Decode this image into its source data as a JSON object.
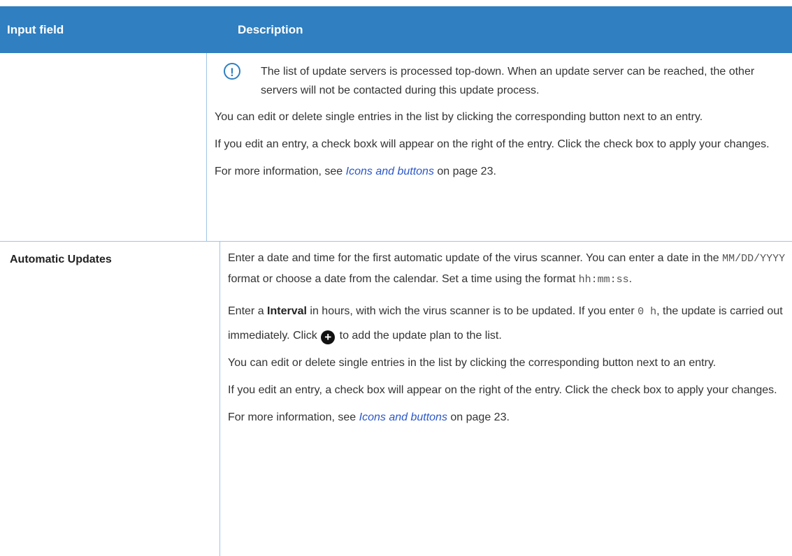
{
  "header": {
    "col1": "Input field",
    "col2": "Description"
  },
  "row1": {
    "field": "",
    "note": "The list of update servers is processed top-down. When an update server can be reached, the other servers will not be contacted during this update process.",
    "p1": "You can edit or delete single entries in the list by clicking the corresponding button next to an entry.",
    "p2": "If you edit an entry, a check boxk will appear on the right of the entry. Click the check box to apply your changes.",
    "p3_before": "For more information, see ",
    "p3_link": "Icons and buttons",
    "p3_after": " on page 23."
  },
  "row2": {
    "field": "Automatic Updates",
    "p1_a": "Enter a date and time for the first automatic update of the virus scanner. You can enter a date in the ",
    "p1_mono1": "MM/DD/YYYY",
    "p1_b": " format or choose a date from the calendar. Set a time using the format ",
    "p1_mono2": "hh:mm:ss",
    "p1_c": ".",
    "p2_a": "Enter a ",
    "p2_bold": "Interval",
    "p2_b": " in hours, with wich the virus scanner is to be updated. If you enter ",
    "p2_mono": "0 h",
    "p2_c": ", the update is carried out immediately. Click ",
    "p2_d": " to add the update plan to the list.",
    "p3": "You can edit or delete single entries in the list by clicking the corresponding button next to an entry.",
    "p4": "If you edit an entry, a check box will appear on the right of the entry. Click the check box to apply your changes.",
    "p5_before": "For more information, see ",
    "p5_link": "Icons and buttons",
    "p5_after": " on page 23."
  },
  "icons": {
    "note": "exclamation-circle-icon",
    "add": "plus-circle-icon"
  },
  "colors": {
    "header_bg": "#2f7fc1",
    "link": "#2b57c9",
    "border": "#9fc5e6"
  }
}
